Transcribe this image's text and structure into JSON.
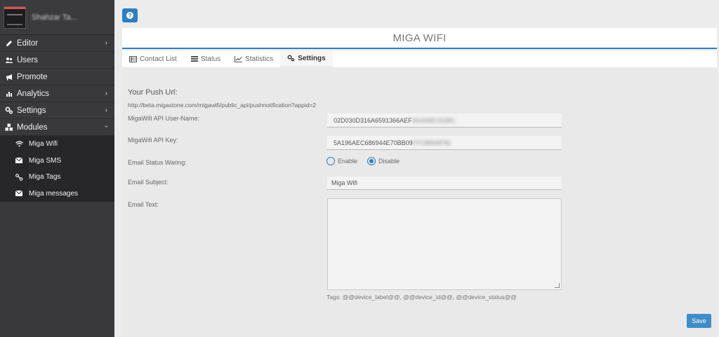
{
  "sidebar": {
    "user_name": "Shahzar Ta...",
    "items": [
      {
        "label": "Editor",
        "icon": "pencil-icon",
        "has_chevron": true
      },
      {
        "label": "Users",
        "icon": "users-icon",
        "has_chevron": false
      },
      {
        "label": "Promote",
        "icon": "bullhorn-icon",
        "has_chevron": false
      },
      {
        "label": "Analytics",
        "icon": "bar-chart-icon",
        "has_chevron": true
      },
      {
        "label": "Settings",
        "icon": "cogs-icon",
        "has_chevron": true
      },
      {
        "label": "Modules",
        "icon": "cubes-icon",
        "has_chevron": true,
        "expanded": true
      }
    ],
    "subitems": [
      {
        "label": "Miga Wifi",
        "icon": "wifi-icon"
      },
      {
        "label": "Miga SMS",
        "icon": "envelope-icon"
      },
      {
        "label": "Miga Tags",
        "icon": "tags-icon"
      },
      {
        "label": "Miga messages",
        "icon": "envelope-icon"
      }
    ]
  },
  "header": {
    "title": "MIGA WIFI",
    "help_icon": "question-icon"
  },
  "tabs": [
    {
      "label": "Contact List",
      "icon": "list-icon",
      "active": false
    },
    {
      "label": "Status",
      "icon": "bars-icon",
      "active": false
    },
    {
      "label": "Statistics",
      "icon": "line-chart-icon",
      "active": false
    },
    {
      "label": "Settings",
      "icon": "cogs-icon",
      "active": true
    }
  ],
  "form": {
    "push_title": "Your Push Url:",
    "push_url": "http://beta.migastone.com/migawifi/public_api/pushnotification?appid=2",
    "api_user_label": "MigaWifi API User-Name:",
    "api_user_value": "02D030D316A6591366AEF",
    "api_user_hidden": "3A4A8EC62BC",
    "api_key_label": "MigaWifi API Key:",
    "api_key_value": "5A196AEC686944E70BB09",
    "api_key_hidden": "FFCB868F5E",
    "email_status_label": "Email Status Waring:",
    "enable_label": "Enable",
    "disable_label": "Disable",
    "selected_option": "Disable",
    "email_subject_label": "Email Subject:",
    "email_subject_value": "Miga Wifi",
    "email_text_label": "Email Text:",
    "email_text_value": "",
    "tags_text": "Tags: @@device_label@@, @@device_id@@, @@device_status@@",
    "save_label": "Save"
  },
  "colors": {
    "accent": "#2d7fc1",
    "sidebar_bg": "#38383d",
    "submenu_bg": "#27272b"
  }
}
